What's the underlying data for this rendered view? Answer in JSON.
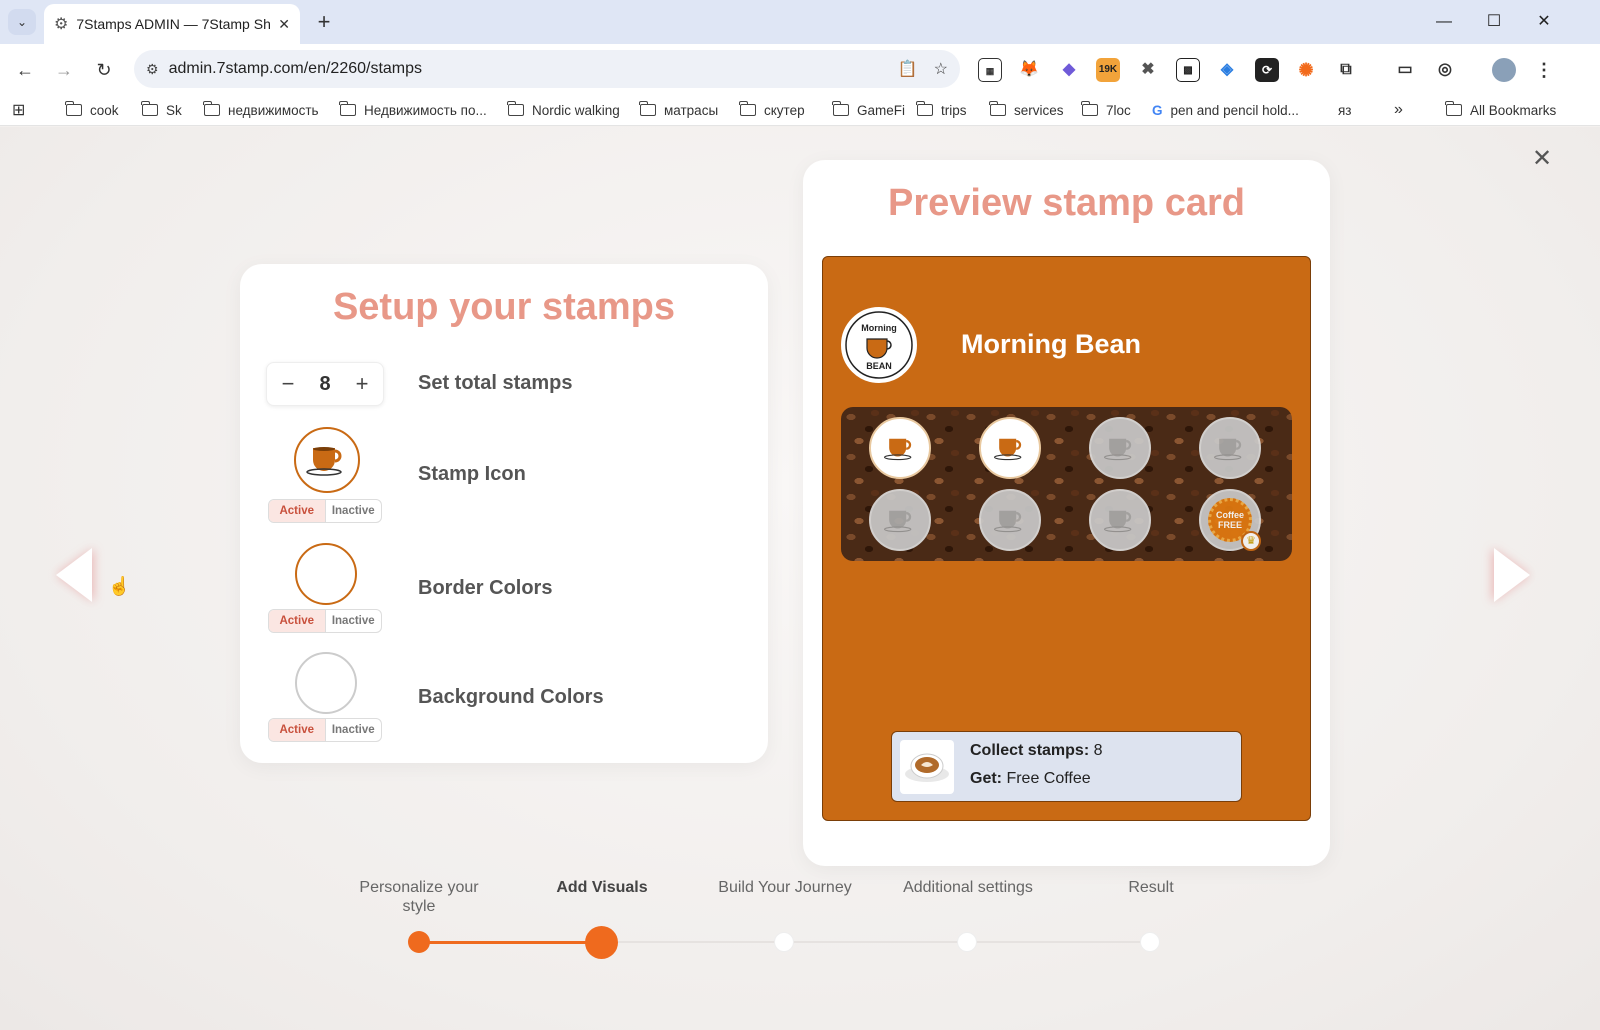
{
  "browser": {
    "tab_title": "7Stamps ADMIN — 7Stamp Sh",
    "url": "admin.7stamp.com/en/2260/stamps",
    "extension_badge": "19K",
    "bookmarks": [
      "cook",
      "Sk",
      "недвижимость",
      "Недвижимость по...",
      "Nordic walking",
      "матрасы",
      "скутер",
      "GameFi",
      "trips",
      "services",
      "7loc",
      "pen and pencil hold...",
      "яз",
      "All Bookmarks"
    ]
  },
  "setup": {
    "title": "Setup your stamps",
    "total_stamps": "8",
    "total_label": "Set total stamps",
    "stamp_icon_label": "Stamp Icon",
    "border_colors_label": "Border Colors",
    "background_colors_label": "Background Colors",
    "toggle_active": "Active",
    "toggle_inactive": "Inactive"
  },
  "preview": {
    "title": "Preview stamp card",
    "business_name": "Morning Bean",
    "logo_text_top": "Morning",
    "logo_text_bottom": "BEAN",
    "stamps_total": 8,
    "stamps_collected": 2,
    "reward_badge_text": "Coffee FREE",
    "collect_label": "Collect stamps:",
    "collect_value": "8",
    "get_label": "Get:",
    "get_value": "Free Coffee",
    "card_color": "#c96a14"
  },
  "progress": {
    "steps": [
      {
        "label": "Personalize your style"
      },
      {
        "label": "Add Visuals"
      },
      {
        "label": "Build Your Journey"
      },
      {
        "label": "Additional settings"
      },
      {
        "label": "Result"
      }
    ],
    "current_step": 2,
    "accent_color": "#ef6a1e"
  }
}
